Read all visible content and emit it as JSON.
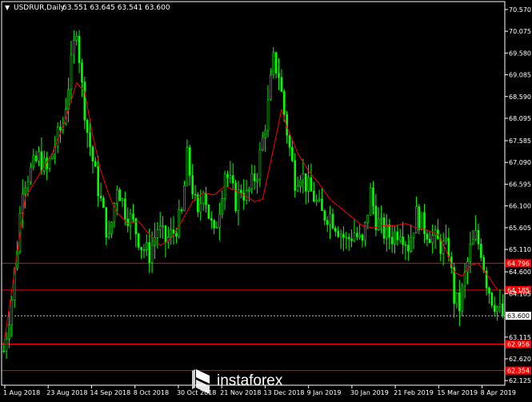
{
  "header": {
    "symbol_label": "USDRUR,Daily",
    "ohlc_label": "63.551 63.645 63.541 63.600"
  },
  "watermark": {
    "text": "instaforex",
    "icon": "instaforex-logo-icon"
  },
  "colors": {
    "background": "#000000",
    "candle": "#00ff00",
    "moving_average": "#ff0000",
    "level_line": "#ff0000",
    "price_line": "#c0c0c0",
    "axis": "#ffffff"
  },
  "chart_data": {
    "type": "candlestick",
    "symbol": "USDRUR",
    "timeframe": "Daily",
    "last_close": 63.6,
    "ylim": [
      62.02,
      70.75
    ],
    "y_ticks": [
      "70.570",
      "70.075",
      "69.580",
      "69.085",
      "68.590",
      "68.095",
      "67.585",
      "67.090",
      "66.595",
      "66.100",
      "65.605",
      "65.110",
      "64.600",
      "64.105",
      "63.115",
      "62.620",
      "62.125"
    ],
    "x_ticks": [
      "1 Aug 2018",
      "23 Aug 2018",
      "14 Sep 2018",
      "8 Oct 2018",
      "30 Oct 2018",
      "21 Nov 2018",
      "13 Dec 2018",
      "9 Jan 2019",
      "30 Jan 2019",
      "21 Feb 2019",
      "15 Mar 2019",
      "8 Apr 2019"
    ],
    "levels": [
      {
        "value": 64.796,
        "label": "64.796"
      },
      {
        "value": 64.185,
        "label": "64.185"
      },
      {
        "value": 62.956,
        "label": "62.956"
      },
      {
        "value": 62.354,
        "label": "62.354"
      }
    ],
    "current_price": {
      "value": 63.6,
      "label": "63.600"
    },
    "trend_points": [
      [
        0,
        62.95
      ],
      [
        4,
        64.6
      ],
      [
        8,
        66.3
      ],
      [
        13,
        66.8
      ],
      [
        18,
        67.3
      ],
      [
        22,
        67.9
      ],
      [
        27,
        68.9
      ],
      [
        30,
        68.7
      ],
      [
        33,
        67.7
      ],
      [
        36,
        66.9
      ],
      [
        39,
        66.35
      ],
      [
        42,
        65.95
      ],
      [
        46,
        65.7
      ],
      [
        50,
        65.75
      ],
      [
        54,
        65.45
      ],
      [
        58,
        65.2
      ],
      [
        62,
        65.35
      ],
      [
        66,
        65.75
      ],
      [
        70,
        66.2
      ],
      [
        74,
        66.4
      ],
      [
        78,
        66.35
      ],
      [
        82,
        66.55
      ],
      [
        86,
        66.45
      ],
      [
        89,
        66.35
      ],
      [
        93,
        66.2
      ],
      [
        96,
        66.25
      ],
      [
        100,
        67.4
      ],
      [
        103,
        68.3
      ],
      [
        105,
        67.9
      ],
      [
        109,
        67.3
      ],
      [
        113,
        66.9
      ],
      [
        117,
        66.6
      ],
      [
        121,
        66.25
      ],
      [
        125,
        66.05
      ],
      [
        129,
        65.85
      ],
      [
        133,
        65.65
      ],
      [
        137,
        65.6
      ],
      [
        141,
        65.65
      ],
      [
        145,
        65.65
      ],
      [
        149,
        65.7
      ],
      [
        153,
        65.6
      ],
      [
        157,
        65.55
      ],
      [
        161,
        65.45
      ],
      [
        164,
        65.1
      ],
      [
        167,
        64.6
      ],
      [
        170,
        64.5
      ],
      [
        173,
        64.75
      ],
      [
        176,
        64.8
      ],
      [
        179,
        64.55
      ],
      [
        183,
        64.2
      ]
    ],
    "candle_path": [
      [
        0,
        62.8
      ],
      [
        3,
        64.0
      ],
      [
        5,
        65.2
      ],
      [
        7,
        66.6
      ],
      [
        10,
        66.9
      ],
      [
        13,
        67.2
      ],
      [
        16,
        66.9
      ],
      [
        19,
        67.5
      ],
      [
        22,
        68.0
      ],
      [
        25,
        69.3
      ],
      [
        27,
        70.2
      ],
      [
        29,
        68.8
      ],
      [
        31,
        67.8
      ],
      [
        34,
        66.8
      ],
      [
        37,
        65.9
      ],
      [
        39,
        65.3
      ],
      [
        42,
        66.6
      ],
      [
        45,
        66.0
      ],
      [
        48,
        65.7
      ],
      [
        51,
        65.2
      ],
      [
        54,
        65.0
      ],
      [
        57,
        65.6
      ],
      [
        60,
        65.3
      ],
      [
        63,
        65.5
      ],
      [
        66,
        65.9
      ],
      [
        68,
        67.2
      ],
      [
        70,
        66.5
      ],
      [
        72,
        65.8
      ],
      [
        74,
        66.6
      ],
      [
        76,
        65.9
      ],
      [
        78,
        65.4
      ],
      [
        80,
        66.1
      ],
      [
        82,
        66.9
      ],
      [
        84,
        66.6
      ],
      [
        86,
        66.2
      ],
      [
        88,
        66.5
      ],
      [
        90,
        66.3
      ],
      [
        92,
        66.6
      ],
      [
        94,
        66.9
      ],
      [
        96,
        67.6
      ],
      [
        98,
        68.4
      ],
      [
        100,
        69.4
      ],
      [
        102,
        69.1
      ],
      [
        104,
        68.2
      ],
      [
        106,
        67.4
      ],
      [
        108,
        66.7
      ],
      [
        110,
        66.9
      ],
      [
        112,
        66.6
      ],
      [
        115,
        66.3
      ],
      [
        118,
        65.9
      ],
      [
        121,
        65.9
      ],
      [
        124,
        65.6
      ],
      [
        127,
        65.3
      ],
      [
        130,
        65.5
      ],
      [
        133,
        65.2
      ],
      [
        136,
        66.4
      ],
      [
        138,
        65.8
      ],
      [
        141,
        65.5
      ],
      [
        144,
        65.4
      ],
      [
        147,
        65.6
      ],
      [
        150,
        65.2
      ],
      [
        153,
        65.9
      ],
      [
        156,
        65.6
      ],
      [
        159,
        65.4
      ],
      [
        162,
        65.2
      ],
      [
        165,
        65.1
      ],
      [
        167,
        64.0
      ],
      [
        169,
        63.8
      ],
      [
        171,
        64.5
      ],
      [
        173,
        65.1
      ],
      [
        175,
        65.4
      ],
      [
        177,
        65.1
      ],
      [
        179,
        64.4
      ],
      [
        181,
        64.0
      ],
      [
        183,
        63.8
      ],
      [
        185,
        63.6
      ]
    ]
  }
}
